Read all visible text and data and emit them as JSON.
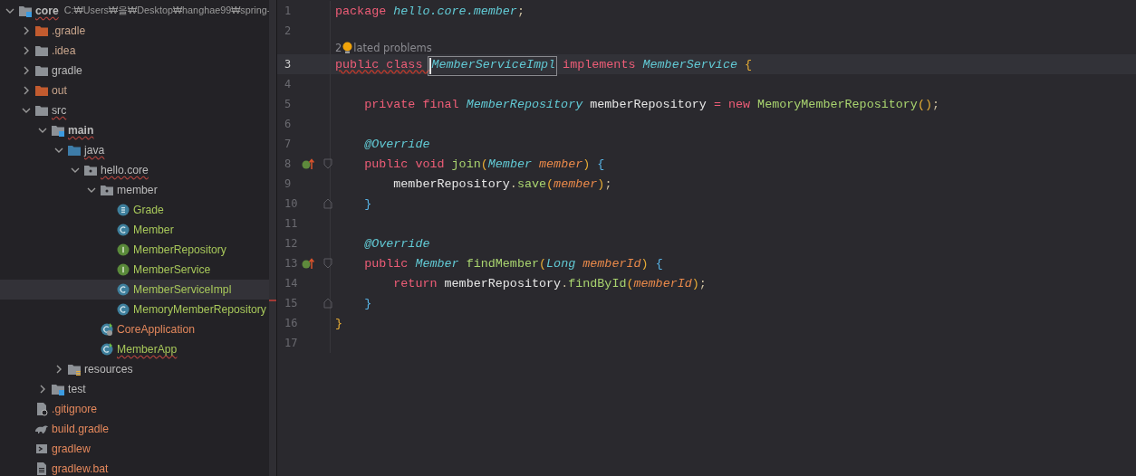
{
  "project_tree": {
    "items": [
      {
        "name": "core",
        "path": "C:₩Users₩을₩Desktop₩hanghae99₩spring-",
        "kind": "module",
        "expanded": true,
        "bold": true,
        "error": true,
        "selected": false,
        "color": "#bbbbbb",
        "children": [
          {
            "name": ".gradle",
            "kind": "folder-excluded",
            "expanded": false,
            "bold": false,
            "error": false,
            "selected": false,
            "color": "#c8a58c"
          },
          {
            "name": ".idea",
            "kind": "folder",
            "expanded": false,
            "bold": false,
            "error": false,
            "selected": false,
            "color": "#c8a58c"
          },
          {
            "name": "gradle",
            "kind": "folder",
            "expanded": false,
            "bold": false,
            "error": false,
            "selected": false,
            "color": "#bbbbbb"
          },
          {
            "name": "out",
            "kind": "folder-excluded",
            "expanded": false,
            "bold": false,
            "error": false,
            "selected": false,
            "color": "#c8a58c"
          },
          {
            "name": "src",
            "kind": "folder",
            "expanded": true,
            "bold": false,
            "error": true,
            "selected": false,
            "color": "#bbbbbb",
            "children": [
              {
                "name": "main",
                "kind": "module",
                "expanded": true,
                "bold": true,
                "error": true,
                "selected": false,
                "color": "#bbbbbb",
                "children": [
                  {
                    "name": "java",
                    "kind": "source-root",
                    "expanded": true,
                    "bold": false,
                    "error": true,
                    "selected": false,
                    "color": "#bbbbbb",
                    "children": [
                      {
                        "name": "hello.core",
                        "kind": "package",
                        "expanded": true,
                        "bold": false,
                        "error": true,
                        "selected": false,
                        "color": "#bbbbbb",
                        "children": [
                          {
                            "name": "member",
                            "kind": "package",
                            "expanded": true,
                            "bold": false,
                            "error": false,
                            "selected": false,
                            "color": "#bbbbbb",
                            "children": [
                              {
                                "name": "Grade",
                                "kind": "enum",
                                "bold": false,
                                "error": false,
                                "selected": false,
                                "color": "#a7c75a"
                              },
                              {
                                "name": "Member",
                                "kind": "class",
                                "bold": false,
                                "error": false,
                                "selected": false,
                                "color": "#a7c75a"
                              },
                              {
                                "name": "MemberRepository",
                                "kind": "interface",
                                "bold": false,
                                "error": false,
                                "selected": false,
                                "color": "#a7c75a"
                              },
                              {
                                "name": "MemberService",
                                "kind": "interface",
                                "bold": false,
                                "error": false,
                                "selected": false,
                                "color": "#a7c75a"
                              },
                              {
                                "name": "MemberServiceImpl",
                                "kind": "class",
                                "bold": false,
                                "error": false,
                                "selected": true,
                                "color": "#a7c75a"
                              },
                              {
                                "name": "MemoryMemberRepository",
                                "kind": "class",
                                "bold": false,
                                "error": false,
                                "selected": false,
                                "color": "#a7c75a"
                              }
                            ]
                          },
                          {
                            "name": "CoreApplication",
                            "kind": "spring-class",
                            "bold": false,
                            "error": false,
                            "selected": false,
                            "color": "#e4885c"
                          },
                          {
                            "name": "MemberApp",
                            "kind": "runnable-class",
                            "bold": false,
                            "error": true,
                            "selected": false,
                            "color": "#a7c75a"
                          }
                        ]
                      }
                    ]
                  },
                  {
                    "name": "resources",
                    "kind": "resource-root",
                    "expanded": false,
                    "bold": false,
                    "error": false,
                    "selected": false,
                    "color": "#bbbbbb"
                  }
                ]
              },
              {
                "name": "test",
                "kind": "module",
                "expanded": false,
                "bold": false,
                "error": false,
                "selected": false,
                "color": "#bbbbbb"
              }
            ]
          },
          {
            "name": ".gitignore",
            "kind": "ignore-file",
            "bold": false,
            "error": false,
            "selected": false,
            "color": "#e4885c"
          },
          {
            "name": "build.gradle",
            "kind": "gradle-file",
            "bold": false,
            "error": false,
            "selected": false,
            "color": "#e4885c"
          },
          {
            "name": "gradlew",
            "kind": "script-file",
            "bold": false,
            "error": false,
            "selected": false,
            "color": "#e4885c"
          },
          {
            "name": "gradlew.bat",
            "kind": "text-file",
            "bold": false,
            "error": false,
            "selected": false,
            "color": "#e4885c"
          }
        ]
      }
    ]
  },
  "editor": {
    "lines": [
      {
        "number": "1",
        "current": false,
        "tokens": [
          {
            "kind": "keyword",
            "text": "package "
          },
          {
            "kind": "type",
            "text": "hello.core.member"
          },
          {
            "kind": "punct",
            "text": ";"
          }
        ]
      },
      {
        "number": "2",
        "current": false
      },
      {
        "number": "3",
        "current": true,
        "hint": {
          "count": "2",
          "text": "lated problems"
        },
        "tokens": [
          {
            "kind": "keyword",
            "text": "public class ",
            "error": true
          },
          {
            "kind": "type",
            "text": "MemberServiceImpl",
            "highlighted": true
          },
          {
            "kind": "keyword",
            "text": " implements "
          },
          {
            "kind": "type",
            "text": "MemberService "
          },
          {
            "kind": "paren",
            "text": "{"
          }
        ]
      },
      {
        "number": "4",
        "current": false
      },
      {
        "number": "5",
        "current": false,
        "tokens": [
          {
            "kind": "keyword",
            "text": "    private final "
          },
          {
            "kind": "type",
            "text": "MemberRepository "
          },
          {
            "kind": "plain",
            "text": "memberRepository "
          },
          {
            "kind": "keyword",
            "text": "= new "
          },
          {
            "kind": "method",
            "text": "MemoryMemberRepository"
          },
          {
            "kind": "paren",
            "text": "()"
          },
          {
            "kind": "punct",
            "text": ";"
          }
        ]
      },
      {
        "number": "6",
        "current": false
      },
      {
        "number": "7",
        "current": false,
        "tokens": [
          {
            "kind": "type",
            "text": "    @Override"
          }
        ]
      },
      {
        "number": "8",
        "current": false,
        "marker": true,
        "fold_open": true,
        "tokens": [
          {
            "kind": "keyword",
            "text": "    public void "
          },
          {
            "kind": "method",
            "text": "join"
          },
          {
            "kind": "paren",
            "text": "("
          },
          {
            "kind": "type",
            "text": "Member "
          },
          {
            "kind": "param",
            "text": "member"
          },
          {
            "kind": "paren",
            "text": ") "
          },
          {
            "kind": "brace",
            "text": "{"
          }
        ]
      },
      {
        "number": "9",
        "current": false,
        "tokens": [
          {
            "kind": "plain",
            "text": "        memberRepository"
          },
          {
            "kind": "punct",
            "text": "."
          },
          {
            "kind": "method",
            "text": "save"
          },
          {
            "kind": "paren",
            "text": "("
          },
          {
            "kind": "param",
            "text": "member"
          },
          {
            "kind": "paren",
            "text": ")"
          },
          {
            "kind": "punct",
            "text": ";"
          }
        ]
      },
      {
        "number": "10",
        "current": false,
        "fold_close": true,
        "tokens": [
          {
            "kind": "brace",
            "text": "    }"
          }
        ]
      },
      {
        "number": "11",
        "current": false
      },
      {
        "number": "12",
        "current": false,
        "tokens": [
          {
            "kind": "type",
            "text": "    @Override"
          }
        ]
      },
      {
        "number": "13",
        "current": false,
        "marker": true,
        "fold_open": true,
        "tokens": [
          {
            "kind": "keyword",
            "text": "    public "
          },
          {
            "kind": "type",
            "text": "Member "
          },
          {
            "kind": "method",
            "text": "findMember"
          },
          {
            "kind": "paren",
            "text": "("
          },
          {
            "kind": "type",
            "text": "Long "
          },
          {
            "kind": "param",
            "text": "memberId"
          },
          {
            "kind": "paren",
            "text": ") "
          },
          {
            "kind": "brace",
            "text": "{"
          }
        ]
      },
      {
        "number": "14",
        "current": false,
        "tokens": [
          {
            "kind": "keyword",
            "text": "        return "
          },
          {
            "kind": "plain",
            "text": "memberRepository"
          },
          {
            "kind": "punct",
            "text": "."
          },
          {
            "kind": "method",
            "text": "findById"
          },
          {
            "kind": "paren",
            "text": "("
          },
          {
            "kind": "param",
            "text": "memberId"
          },
          {
            "kind": "paren",
            "text": ")"
          },
          {
            "kind": "punct",
            "text": ";"
          }
        ]
      },
      {
        "number": "15",
        "current": false,
        "fold_close": true,
        "tokens": [
          {
            "kind": "brace",
            "text": "    }"
          }
        ]
      },
      {
        "number": "16",
        "current": false,
        "tokens": [
          {
            "kind": "paren",
            "text": "}"
          }
        ]
      },
      {
        "number": "17",
        "current": false
      }
    ]
  }
}
